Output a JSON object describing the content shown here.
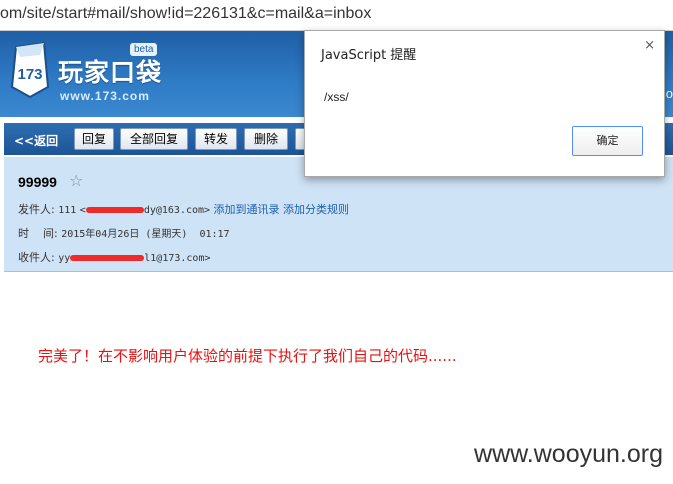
{
  "address_bar": {
    "url": "om/site/start#mail/show!id=226131&c=mail&a=inbox"
  },
  "header": {
    "logo_title": "玩家口袋",
    "logo_badge": "beta",
    "logo_number": "173",
    "logo_url": "www.173.com",
    "cut_text": "o"
  },
  "toolbar": {
    "back_label": "<<返回",
    "buttons": [
      "回复",
      "全部回复",
      "转发",
      "删除"
    ]
  },
  "mail": {
    "subject": "99999",
    "from_label": "发件人:",
    "from_name": "111",
    "from_email_visible": "dy@163.com>",
    "add_contact": "添加到通讯录",
    "add_rule": "添加分类规则",
    "time_label": "时    间:",
    "time_value": "2015年04月26日 (星期天)  01:17",
    "to_label": "收件人:",
    "to_prefix": "yy",
    "to_email_visible": "l1@173.com>"
  },
  "body_note": "完美了！在不影响用户体验的前提下执行了我们自己的代码......",
  "watermark": "www.wooyun.org",
  "alert": {
    "title": "JavaScript 提醒",
    "message": "/xss/",
    "ok_label": "确定",
    "close_symbol": "×"
  },
  "colors": {
    "header_blue": "#2f7cc6",
    "panel_blue": "#cfe3f6",
    "redaction_red": "#ee2a2a",
    "note_red": "#e81010"
  }
}
